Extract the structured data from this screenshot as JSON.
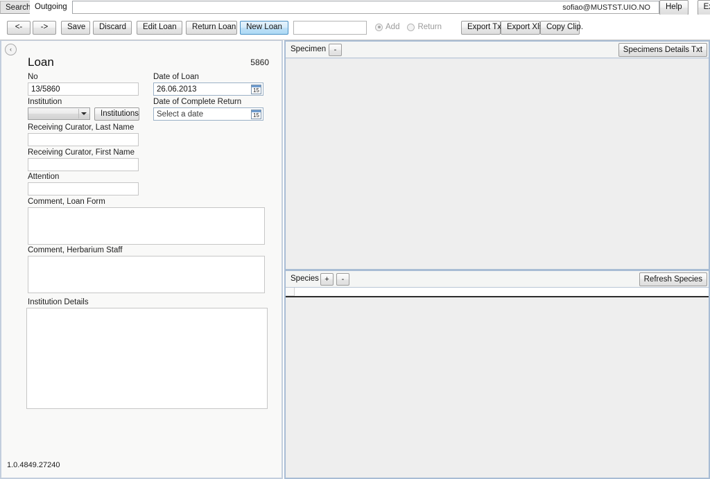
{
  "tabs": {
    "inactive_label": "Search",
    "active_label": "Outgoing"
  },
  "header": {
    "username": "sofiao@MUSTST.UIO.NO",
    "help_label": "Help",
    "exit_label": "Exit"
  },
  "toolbar": {
    "prev_label": "<-",
    "next_label": "->",
    "save_label": "Save",
    "discard_label": "Discard",
    "edit_loan_label": "Edit Loan",
    "return_loan_label": "Return Loan",
    "new_loan_label": "New Loan",
    "search_value": "",
    "search_placeholder": "",
    "add_radio_label": "Add",
    "return_radio_label": "Return",
    "export_txt_label": "Export Txt",
    "export_xls_label": "Export Xls",
    "copy_clip_label": "Copy Clip."
  },
  "loan": {
    "collapse_icon": "‹",
    "title": "Loan",
    "id": "5860",
    "no_label": "No",
    "no_value": "13/5860",
    "institution_label": "Institution",
    "institution_value": "",
    "institutions_button": "Institutions",
    "curator_last_label": "Receiving Curator, Last Name",
    "curator_last_value": "",
    "curator_first_label": "Receiving Curator, First Name",
    "curator_first_value": "",
    "attention_label": "Attention",
    "attention_value": "",
    "comment_loan_form_label": "Comment, Loan Form",
    "comment_loan_form_value": "",
    "comment_herbarium_label": "Comment, Herbarium Staff",
    "comment_herbarium_value": "",
    "institution_details_label": "Institution Details",
    "institution_details_value": "",
    "date_of_loan_label": "Date of Loan",
    "date_of_loan_value": "26.06.2013",
    "date_complete_return_label": "Date of Complete Return",
    "date_complete_return_value": "Select a date",
    "calendar_day": "15",
    "version": "1.0.4849.27240"
  },
  "specimen": {
    "title": "Specimen",
    "minus_label": "-",
    "details_button": "Specimens Details Txt"
  },
  "species": {
    "title": "Species",
    "plus_label": "+",
    "minus_label": "-",
    "refresh_button": "Refresh Species"
  }
}
